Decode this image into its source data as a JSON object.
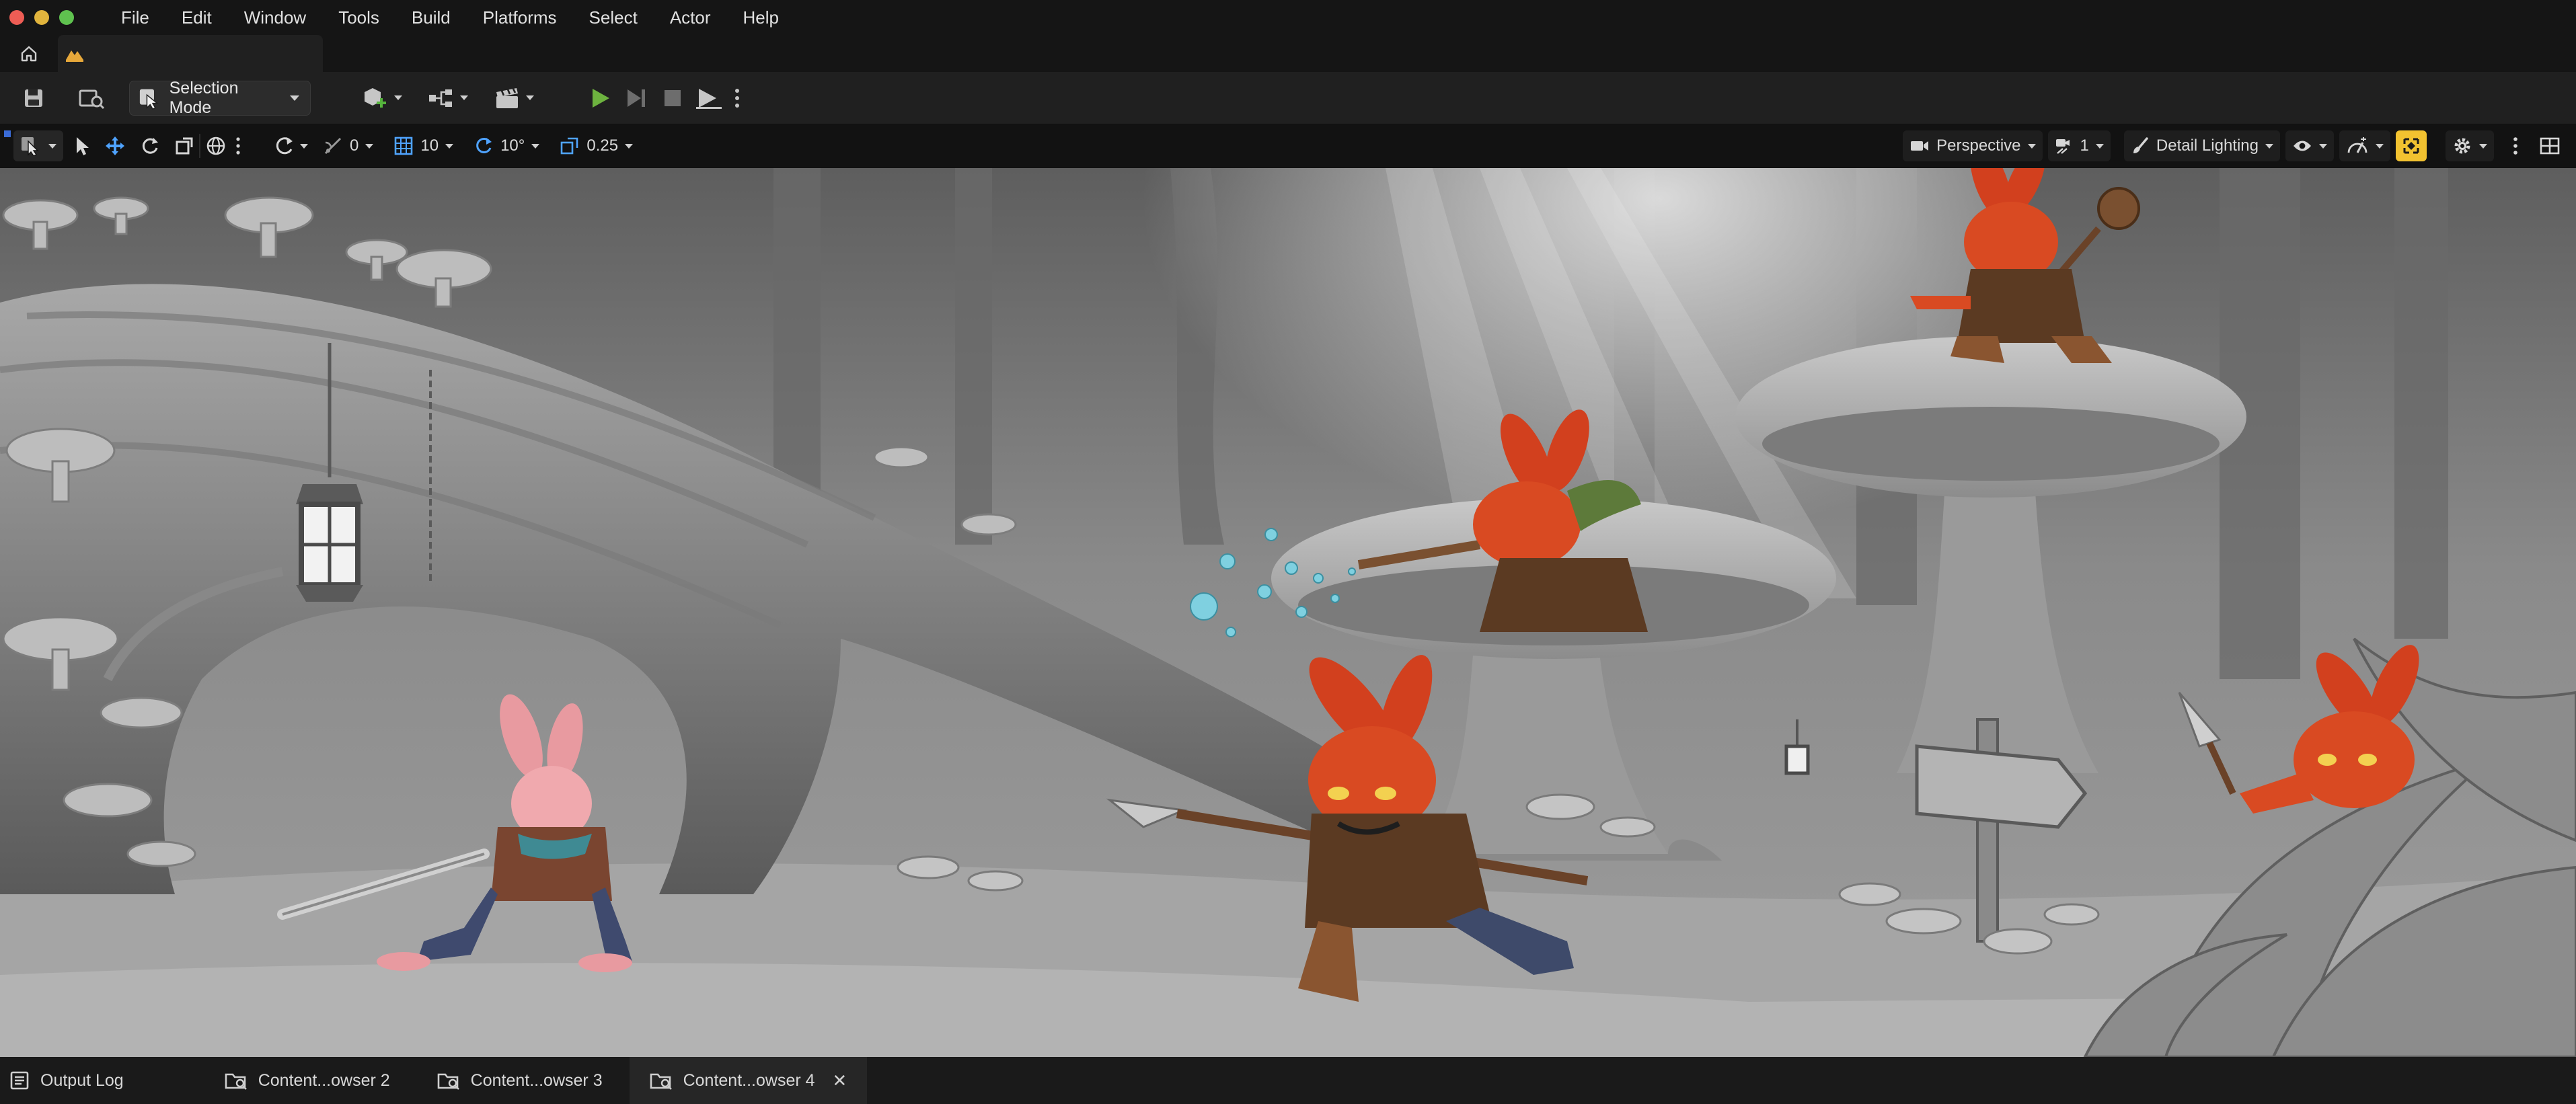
{
  "menu": {
    "items": [
      "File",
      "Edit",
      "Window",
      "Tools",
      "Build",
      "Platforms",
      "Select",
      "Actor",
      "Help"
    ]
  },
  "toolbar": {
    "mode_label": "Selection Mode",
    "play_color": "#6db33f"
  },
  "viewport_toolbar": {
    "rotation_snap_value": "0",
    "grid_snap_value": "10",
    "angle_snap_value": "10°",
    "scale_snap_value": "0.25",
    "perspective_label": "Perspective",
    "camera_speed_value": "1",
    "view_mode_label": "Detail Lighting",
    "accent_color": "#f2c230"
  },
  "bottom_bar": {
    "output_log_label": "Output Log",
    "content_tabs": [
      "Content...owser 2",
      "Content...owser 3",
      "Content...owser 4"
    ],
    "close_glyph": "✕"
  },
  "scene": {
    "subject": "fantasy forest battle",
    "characters": [
      "hero-rabbit",
      "blowgun-goblin",
      "spear-goblin",
      "flail-goblin",
      "dagger-goblin"
    ]
  }
}
